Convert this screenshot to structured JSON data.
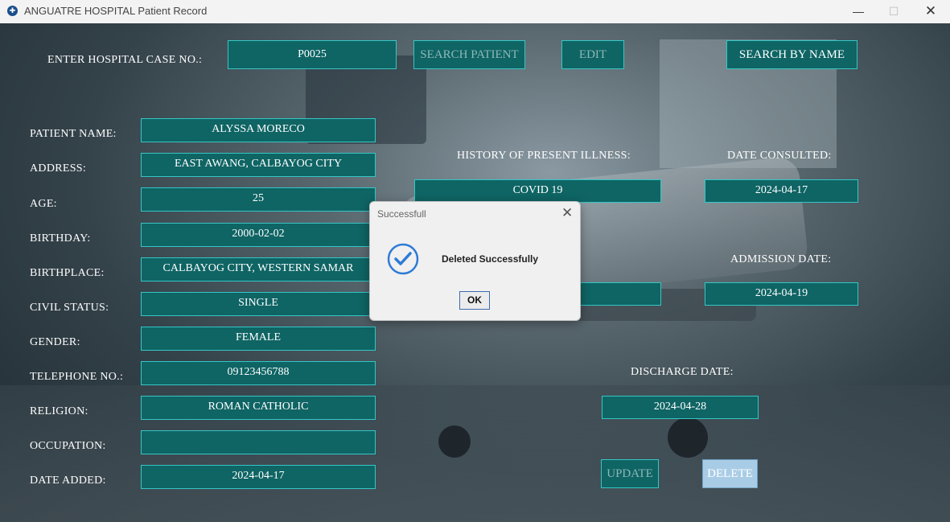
{
  "window": {
    "title": "ANGUATRE HOSPITAL Patient Record"
  },
  "top": {
    "case_label": "ENTER HOSPITAL CASE NO.:",
    "case_value": "P0025",
    "search_patient": "SEARCH PATIENT",
    "edit": "EDIT",
    "search_by_name": "SEARCH BY NAME"
  },
  "form": {
    "patient_name": {
      "label": "PATIENT NAME:",
      "value": "ALYSSA MORECO"
    },
    "address": {
      "label": "ADDRESS:",
      "value": "EAST AWANG, CALBAYOG CITY"
    },
    "age": {
      "label": "AGE:",
      "value": "25"
    },
    "birthday": {
      "label": "BIRTHDAY:",
      "value": "2000-02-02"
    },
    "birthplace": {
      "label": "BIRTHPLACE:",
      "value": "CALBAYOG CITY, WESTERN SAMAR"
    },
    "civil_status": {
      "label": "CIVIL STATUS:",
      "value": "SINGLE"
    },
    "gender": {
      "label": "GENDER:",
      "value": "FEMALE"
    },
    "telephone": {
      "label": "TELEPHONE NO.:",
      "value": "09123456788"
    },
    "religion": {
      "label": "RELIGION:",
      "value": "ROMAN CATHOLIC"
    },
    "occupation": {
      "label": "OCCUPATION:",
      "value": ""
    },
    "date_added": {
      "label": "DATE ADDED:",
      "value": "2024-04-17"
    }
  },
  "right": {
    "history_label": "HISTORY OF PRESENT ILLNESS:",
    "history_value": "COVID 19",
    "date_consulted_label": "DATE CONSULTED:",
    "date_consulted_value": "2024-04-17",
    "partial_label_fragment": ":",
    "partial_field_value": "",
    "admission_label": "ADMISSION DATE:",
    "admission_value": "2024-04-19",
    "discharge_label": "DISCHARGE DATE:",
    "discharge_value": "2024-04-28",
    "update": "UPDATE",
    "delete": "DELETE"
  },
  "dialog": {
    "title": "Successfull",
    "message": "Deleted Successfully",
    "ok": "OK",
    "icon": "info-check-icon"
  },
  "colors": {
    "field_bg": "#0f6464",
    "field_border": "#36c6c6",
    "dialog_icon": "#2e7bd6"
  }
}
